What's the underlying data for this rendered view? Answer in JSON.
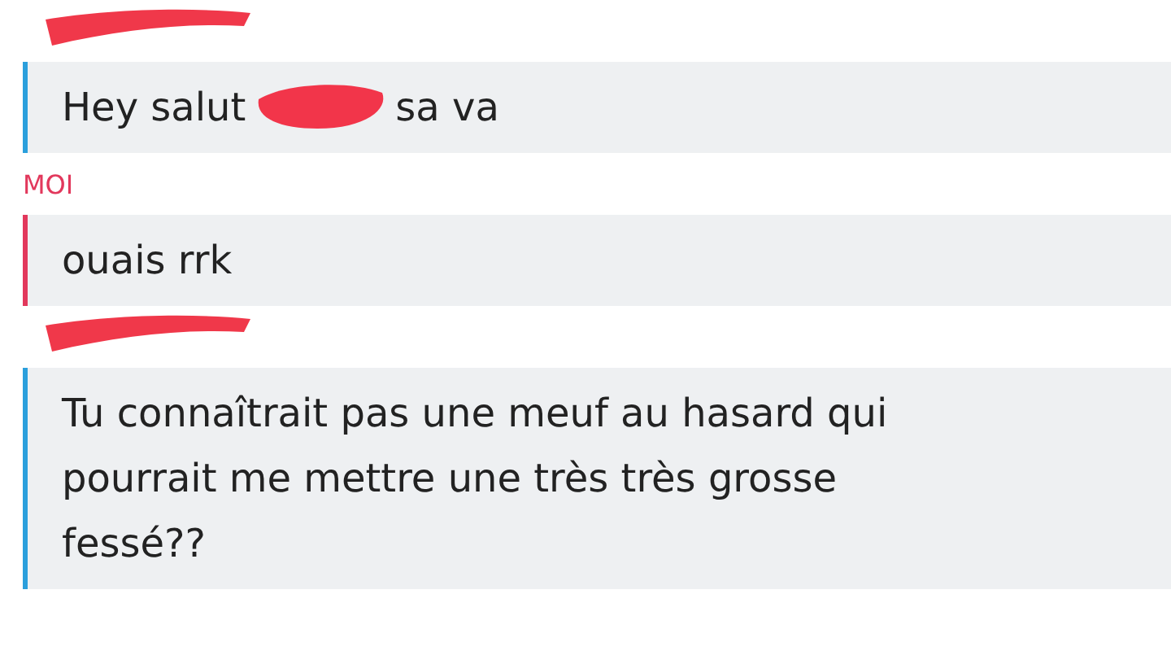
{
  "messages": [
    {
      "sender": {
        "kind": "redacted"
      },
      "color": "#2b9fdc",
      "lines": [
        [
          {
            "kind": "text",
            "text": "Hey salut"
          },
          {
            "kind": "redaction"
          },
          {
            "kind": "text",
            "text": "sa va"
          }
        ]
      ]
    },
    {
      "sender": {
        "kind": "name",
        "text": "MOI"
      },
      "color": "#e2385c",
      "lines": [
        [
          {
            "kind": "text",
            "text": "ouais rrk"
          }
        ]
      ]
    },
    {
      "sender": {
        "kind": "redacted"
      },
      "color": "#2b9fdc",
      "lines": [
        [
          {
            "kind": "text",
            "text": "Tu connaîtrait pas une meuf au hasard qui"
          }
        ],
        [
          {
            "kind": "text",
            "text": "pourrait me mettre une très très grosse"
          }
        ],
        [
          {
            "kind": "text",
            "text": "fessé??"
          }
        ]
      ]
    }
  ]
}
